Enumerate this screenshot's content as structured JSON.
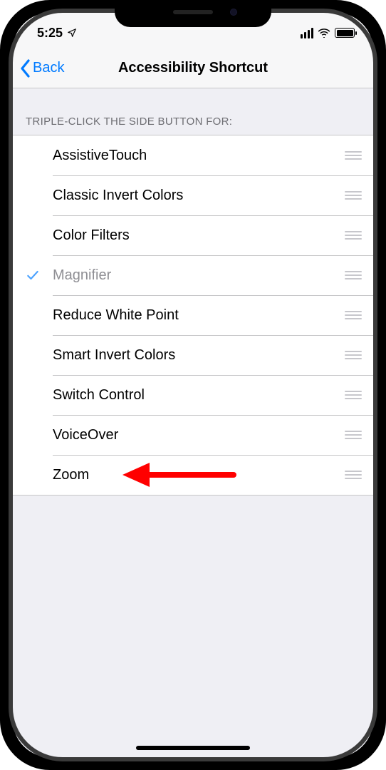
{
  "statusBar": {
    "time": "5:25"
  },
  "nav": {
    "back": "Back",
    "title": "Accessibility Shortcut"
  },
  "sectionHeader": "TRIPLE-CLICK THE SIDE BUTTON FOR:",
  "items": [
    {
      "label": "AssistiveTouch",
      "selected": false
    },
    {
      "label": "Classic Invert Colors",
      "selected": false
    },
    {
      "label": "Color Filters",
      "selected": false
    },
    {
      "label": "Magnifier",
      "selected": true
    },
    {
      "label": "Reduce White Point",
      "selected": false
    },
    {
      "label": "Smart Invert Colors",
      "selected": false
    },
    {
      "label": "Switch Control",
      "selected": false
    },
    {
      "label": "VoiceOver",
      "selected": false
    },
    {
      "label": "Zoom",
      "selected": false
    }
  ],
  "annotation": {
    "target": "Zoom",
    "color": "#ff0000"
  }
}
